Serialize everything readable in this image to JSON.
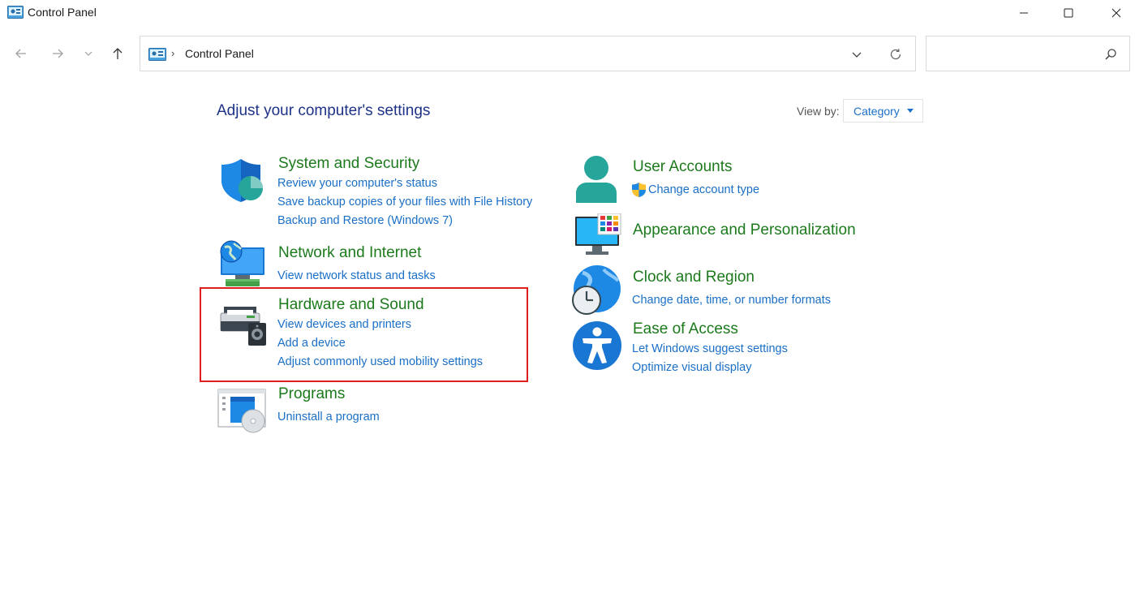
{
  "window": {
    "title": "Control Panel",
    "app_icon": "control-panel-icon",
    "controls": [
      "minimize-icon",
      "maximize-icon",
      "close-icon"
    ]
  },
  "nav": {
    "back_icon": "arrow-left-icon",
    "forward_icon": "arrow-right-icon",
    "recent_icon": "chevron-down-icon",
    "up_icon": "arrow-up-icon"
  },
  "address": {
    "icon": "control-panel-icon",
    "separator": "›",
    "path": "Control Panel",
    "dropdown_icon": "chevron-down-icon",
    "refresh_icon": "refresh-icon"
  },
  "search": {
    "placeholder": "",
    "icon": "search-icon"
  },
  "content": {
    "title": "Adjust your computer's settings",
    "view_by_label": "View by:",
    "view_by_value": "Category"
  },
  "categories": {
    "system_security": {
      "icon": "shield-icon",
      "title": "System and Security",
      "links": [
        "Review your computer's status",
        "Save backup copies of your files with File History",
        "Backup and Restore (Windows 7)"
      ]
    },
    "network": {
      "icon": "network-globe-icon",
      "title": "Network and Internet",
      "links": [
        "View network status and tasks"
      ]
    },
    "hardware": {
      "icon": "printer-speaker-icon",
      "title": "Hardware and Sound",
      "links": [
        "View devices and printers",
        "Add a device",
        "Adjust commonly used mobility settings"
      ]
    },
    "programs": {
      "icon": "programs-disc-icon",
      "title": "Programs",
      "links": [
        "Uninstall a program"
      ]
    },
    "user_accounts": {
      "icon": "user-icon",
      "title": "User Accounts",
      "links": [
        "Change account type"
      ],
      "link_icon": "uac-shield-icon"
    },
    "appearance": {
      "icon": "monitor-palette-icon",
      "title": "Appearance and Personalization",
      "links": []
    },
    "clock": {
      "icon": "globe-clock-icon",
      "title": "Clock and Region",
      "links": [
        "Change date, time, or number formats"
      ]
    },
    "ease": {
      "icon": "accessibility-icon",
      "title": "Ease of Access",
      "links": [
        "Let Windows suggest settings",
        "Optimize visual display"
      ]
    }
  },
  "colors": {
    "title_blue": "#1e3287",
    "category_green": "#1c7a1c",
    "link_blue": "#1a6fc7",
    "highlight_red": "#e01e1e"
  }
}
